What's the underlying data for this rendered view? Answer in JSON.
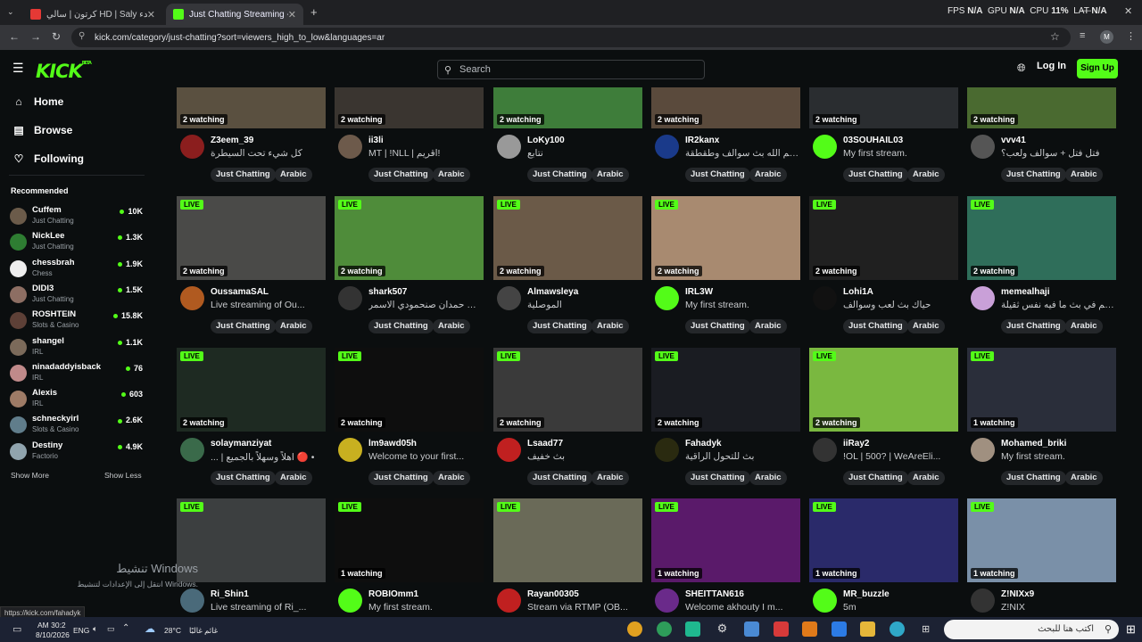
{
  "browser": {
    "tabs": [
      {
        "label": "كرتون | سالي HD | Saly ج 34 | بدء..."
      },
      {
        "label": "Just Chatting Streaming - Live S..."
      }
    ],
    "new_tab": "+",
    "url": "kick.com/category/just-chatting?sort=viewers_high_to_low&languages=ar",
    "perf": {
      "fps_label": "FPS",
      "fps": "N/A",
      "gpu_label": "GPU",
      "gpu": "N/A",
      "cpu_label": "CPU",
      "cpu": "11%",
      "lat_label": "LAT",
      "lat": "N/A"
    },
    "profile": "M"
  },
  "header": {
    "logo": "KICK",
    "logo_sup": "BETA",
    "search_placeholder": "Search",
    "login": "Log In",
    "signup": "Sign Up"
  },
  "sidebar": {
    "nav": [
      {
        "label": "Home",
        "icon": "home-icon"
      },
      {
        "label": "Browse",
        "icon": "browse-icon"
      },
      {
        "label": "Following",
        "icon": "heart-icon"
      }
    ],
    "recommended_title": "Recommended",
    "recommended": [
      {
        "name": "Cuffem",
        "category": "Just Chatting",
        "viewers": "10K",
        "color": "#6b5b4a"
      },
      {
        "name": "NickLee",
        "category": "Just Chatting",
        "viewers": "1.3K",
        "color": "#2e7d32"
      },
      {
        "name": "chessbrah",
        "category": "Chess",
        "viewers": "1.9K",
        "color": "#eeeeee"
      },
      {
        "name": "DIDI3",
        "category": "Just Chatting",
        "viewers": "1.5K",
        "color": "#8d6e63"
      },
      {
        "name": "ROSHTEIN",
        "category": "Slots & Casino",
        "viewers": "15.8K",
        "color": "#5d4037"
      },
      {
        "name": "shangel",
        "category": "IRL",
        "viewers": "1.1K",
        "color": "#7b6a5a"
      },
      {
        "name": "ninadaddyisback",
        "category": "IRL",
        "viewers": "76",
        "color": "#c08a8a"
      },
      {
        "name": "Alexis",
        "category": "IRL",
        "viewers": "603",
        "color": "#9e7b66"
      },
      {
        "name": "schneckyirl",
        "category": "Slots & Casino",
        "viewers": "2.6K",
        "color": "#607d8b"
      },
      {
        "name": "Destiny",
        "category": "Factorio",
        "viewers": "4.9K",
        "color": "#90a4ae"
      }
    ],
    "show_more": "Show More",
    "show_less": "Show Less"
  },
  "tags": {
    "just_chatting": "Just Chatting",
    "arabic": "Arabic"
  },
  "live_label": "LIVE",
  "streams": [
    {
      "name": "Z3eem_39",
      "title": "كل شيء تحت السيطرة",
      "watching": "2 watching",
      "live": false,
      "thumb": "#5a5040",
      "av": "#8b1e1e",
      "tags": true
    },
    {
      "name": "ii3li",
      "title": "MT | !NLL | اقريم!",
      "watching": "2 watching",
      "live": false,
      "thumb": "#3a3530",
      "av": "#6d5a4b",
      "tags": true
    },
    {
      "name": "LoKy100",
      "title": "نتابع",
      "watching": "2 watching",
      "live": false,
      "thumb": "#3e7d3a",
      "av": "#999",
      "tags": true
    },
    {
      "name": "IR2kanx",
      "title": "حياكم الله بث سوالف وطقطقة",
      "watching": "2 watching",
      "live": false,
      "thumb": "#5a4a3c",
      "av": "#1a3a8a",
      "tags": true
    },
    {
      "name": "03SOUHAIL03",
      "title": "My first stream.",
      "watching": "2 watching",
      "live": false,
      "thumb": "#2a2d30",
      "av": "#53fc18",
      "tags": true
    },
    {
      "name": "vvv41",
      "title": "فتل فتل + سوالف ولعب؟",
      "watching": "2 watching",
      "live": false,
      "thumb": "#4a6a30",
      "av": "#555",
      "tags": true
    },
    {
      "name": "OussamaSAL",
      "title": "Live streaming of Ou...",
      "watching": "2 watching",
      "live": true,
      "thumb": "#4a4a48",
      "av": "#b05a20",
      "tags": true
    },
    {
      "name": "shark507",
      "title": "ذبايف حمدان صنحمودي الاسمر...",
      "watching": "2 watching",
      "live": true,
      "thumb": "#4f8c3a",
      "av": "#333",
      "tags": true
    },
    {
      "name": "Almawsleya",
      "title": "الموصلية",
      "watching": "2 watching",
      "live": true,
      "thumb": "#6b5a48",
      "av": "#444",
      "tags": true
    },
    {
      "name": "IRL3W",
      "title": "My first stream.",
      "watching": "2 watching",
      "live": true,
      "thumb": "#a88a70",
      "av": "#53fc18",
      "tags": true
    },
    {
      "name": "Lohi1A",
      "title": "حياك بث لعب وسوالف",
      "watching": "2 watching",
      "live": true,
      "thumb": "#202020",
      "av": "#111",
      "tags": true
    },
    {
      "name": "memealhaji",
      "title": "حياكم في بث ما فيه نفس ثقيلة...",
      "watching": "2 watching",
      "live": true,
      "thumb": "#2f6e5a",
      "av": "#c9a0d8",
      "tags": true
    },
    {
      "name": "solaymanziyat",
      "title": "... | اهلاً وسهلاً بالجميع 🔴 •",
      "watching": "2 watching",
      "live": true,
      "thumb": "#1e2a22",
      "av": "#3a6a4a",
      "tags": true
    },
    {
      "name": "lm9awd05h",
      "title": "Welcome to your first...",
      "watching": "2 watching",
      "live": true,
      "thumb": "#0e0e0e",
      "av": "#c8b020",
      "tags": true
    },
    {
      "name": "Lsaad77",
      "title": "بث خفيف",
      "watching": "2 watching",
      "live": true,
      "thumb": "#3a3a3a",
      "av": "#c02020",
      "tags": true
    },
    {
      "name": "Fahadyk",
      "title": "بث للتحول الراقية",
      "watching": "2 watching",
      "live": true,
      "thumb": "#1a1c22",
      "av": "#2a2a10",
      "tags": true
    },
    {
      "name": "iiRay2",
      "title": "!OL | 500? | WeAreEli...",
      "watching": "2 watching",
      "live": true,
      "thumb": "#7ab840",
      "av": "#333",
      "tags": true
    },
    {
      "name": "Mohamed_briki",
      "title": "My first stream.",
      "watching": "1 watching",
      "live": true,
      "thumb": "#2a2e3a",
      "av": "#a09080",
      "tags": true
    },
    {
      "name": "Ri_Shin1",
      "title": "Live streaming of Ri_...",
      "watching": "",
      "live": true,
      "thumb": "#3c3f40",
      "av": "#4a6a7a",
      "tags": false
    },
    {
      "name": "ROBIOmm1",
      "title": "My first stream.",
      "watching": "1 watching",
      "live": true,
      "thumb": "#0e0e0e",
      "av": "#53fc18",
      "tags": false
    },
    {
      "name": "Rayan00305",
      "title": "Stream via RTMP (OB...",
      "watching": "",
      "live": true,
      "thumb": "#6a6a58",
      "av": "#c02020",
      "tags": false
    },
    {
      "name": "SHEITTAN616",
      "title": "Welcome akhouty I m...",
      "watching": "1 watching",
      "live": true,
      "thumb": "#5a1a6a",
      "av": "#6a2a8a",
      "tags": false
    },
    {
      "name": "MR_buzzle",
      "title": "5m",
      "watching": "1 watching",
      "live": true,
      "thumb": "#2a2a6a",
      "av": "#53fc18",
      "tags": false
    },
    {
      "name": "Z!NIXx9",
      "title": "Z!NIX",
      "watching": "1 watching",
      "live": true,
      "thumb": "#7a90a8",
      "av": "#333",
      "tags": false
    }
  ],
  "status_url": "https://kick.com/fahadyk",
  "watermark": {
    "line1": "تنشيط Windows",
    "line2": "انتقل إلى الإعدادات لتنشيط Windows."
  },
  "taskbar": {
    "time": "AM 30:2",
    "date": "8/10/2026",
    "lang": "ENG",
    "temp": "28°C",
    "weather": "غائم غالبًا",
    "search_placeholder": "اكتب هنا للبحث"
  }
}
